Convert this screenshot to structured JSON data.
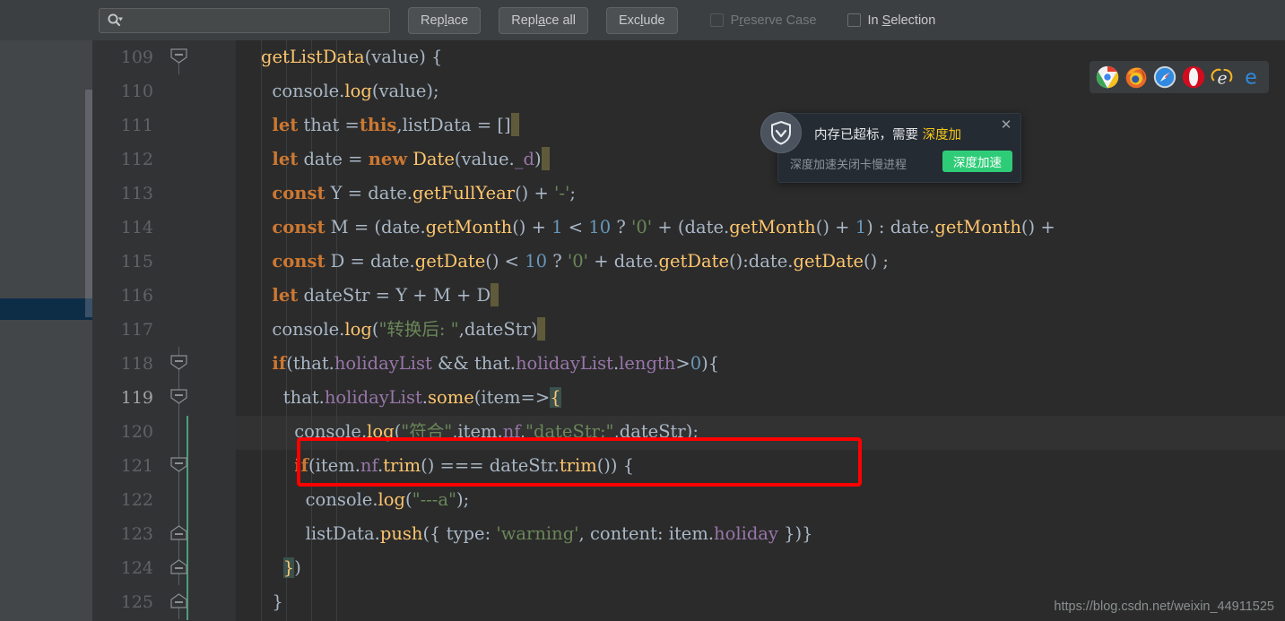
{
  "toolbar": {
    "search": {
      "value": "",
      "placeholder": "",
      "icon": "search-icon"
    },
    "buttons": [
      {
        "name": "replace-button",
        "pre": "Rep",
        "mnemonic": "l",
        "post": "ace"
      },
      {
        "name": "replace-all-button",
        "pre": "Repl",
        "mnemonic": "a",
        "post": "ce all"
      },
      {
        "name": "exclude-button",
        "pre": "Exc",
        "mnemonic": "l",
        "post": "ude"
      }
    ],
    "checkboxes": [
      {
        "name": "preserve-case-checkbox",
        "pre": "P",
        "mnemonic": "r",
        "post": "eserve Case",
        "checked": false,
        "disabled": true
      },
      {
        "name": "in-selection-checkbox",
        "pre": "In ",
        "mnemonic": "S",
        "post": "election",
        "checked": false,
        "disabled": false
      }
    ]
  },
  "editor": {
    "current_line": 119,
    "first_line": 109,
    "line_numbers": [
      109,
      110,
      111,
      112,
      113,
      114,
      115,
      116,
      117,
      118,
      119,
      120,
      121,
      122,
      123,
      124,
      125
    ],
    "code": [
      "getListData(value) {",
      "  console.log(value);",
      "  let that =this,listData = []",
      "  let date = new Date(value._d)",
      "  const Y = date.getFullYear() + '-';",
      "  const M = (date.getMonth() + 1 < 10 ? '0' + (date.getMonth() + 1) : date.getMonth() +",
      "  const D = date.getDate() < 10 ? '0' + date.getDate():date.getDate() ;",
      "  let dateStr = Y + M + D",
      "  console.log(\"转换后: \",dateStr)",
      "  if(that.holidayList && that.holidayList.length>0){",
      "    that.holidayList.some(item=>{",
      "      console.log(\"符合\",item.nf,\"dateStr:\",dateStr);",
      "      if(item.nf.trim() === dateStr.trim()) {",
      "        console.log(\"---a\");",
      "        listData.push({ type: 'warning', content: item.holiday })}",
      "    })",
      "  }"
    ],
    "annotation": {
      "name": "red-highlight-box",
      "target_line": 121,
      "color": "#fe0000"
    }
  },
  "popup": {
    "name": "memory-alert-popup",
    "icon": "shield-icon",
    "title_text": "内存已超标，需要 ",
    "title_accent": "深度加",
    "subtitle": "深度加速关闭卡慢进程",
    "action_label": "深度加速",
    "close_label": "✕",
    "accent_color": "#f5c518",
    "button_color": "#2fcc78"
  },
  "browser_strip": {
    "icons": [
      {
        "name": "chrome-icon",
        "label": "Chrome"
      },
      {
        "name": "firefox-icon",
        "label": "Firefox"
      },
      {
        "name": "safari-icon",
        "label": "Safari"
      },
      {
        "name": "opera-icon",
        "label": "Opera"
      },
      {
        "name": "internet-explorer-icon",
        "label": "Internet Explorer"
      },
      {
        "name": "edge-icon",
        "label": "Edge"
      }
    ]
  },
  "watermark": {
    "text": "https://blog.csdn.net/weixin_44911525"
  }
}
